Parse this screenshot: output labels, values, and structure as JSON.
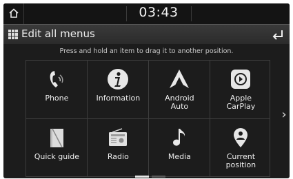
{
  "status": {
    "time": "03:43"
  },
  "header": {
    "title": "Edit all menus"
  },
  "hint": "Press and hold an item to drag it to another position.",
  "menus": [
    {
      "label": "Phone",
      "icon": "phone-icon"
    },
    {
      "label": "Information",
      "icon": "info-icon"
    },
    {
      "label": "Android\nAuto",
      "icon": "android-auto-icon"
    },
    {
      "label": "Apple\nCarPlay",
      "icon": "carplay-icon"
    },
    {
      "label": "Quick guide",
      "icon": "book-icon"
    },
    {
      "label": "Radio",
      "icon": "radio-icon"
    },
    {
      "label": "Media",
      "icon": "music-note-icon"
    },
    {
      "label": "Current\nposition",
      "icon": "location-pin-icon"
    }
  ],
  "pager": {
    "pages": 2,
    "current": 1
  }
}
